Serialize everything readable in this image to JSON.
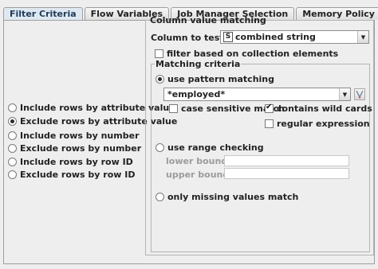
{
  "tabs": [
    {
      "label": "Filter Criteria",
      "active": true
    },
    {
      "label": "Flow Variables",
      "active": false
    },
    {
      "label": "Job Manager Selection",
      "active": false
    },
    {
      "label": "Memory Policy",
      "active": false
    }
  ],
  "filter_modes": [
    {
      "label": "Include rows by attribute value",
      "selected": false
    },
    {
      "label": "Exclude rows by attribute value",
      "selected": true
    },
    {
      "label": "Include rows by number",
      "selected": false
    },
    {
      "label": "Exclude rows by number",
      "selected": false
    },
    {
      "label": "Include rows by row ID",
      "selected": false
    },
    {
      "label": "Exclude rows by row ID",
      "selected": false
    }
  ],
  "column_matching": {
    "legend": "Column value matching",
    "column_label": "Column to test:",
    "column_type_badge": "S",
    "column_value": "combined string",
    "collection_label": "filter based on collection elements",
    "collection_checked": false
  },
  "matching_criteria": {
    "legend": "Matching criteria",
    "pattern_label": "use pattern matching",
    "pattern_selected": true,
    "pattern_value": "*employed*",
    "case_sensitive_label": "case sensitive match",
    "case_sensitive_checked": false,
    "wildcards_label": "contains wild cards",
    "wildcards_checked": true,
    "regex_label": "regular expression",
    "regex_checked": false,
    "range_label": "use range checking",
    "range_selected": false,
    "lower_bound_label": "lower bound:",
    "upper_bound_label": "upper bound:",
    "missing_label": "only missing values match",
    "missing_selected": false
  },
  "icons": {
    "pattern_variable_button": "flow-variable-icon"
  }
}
